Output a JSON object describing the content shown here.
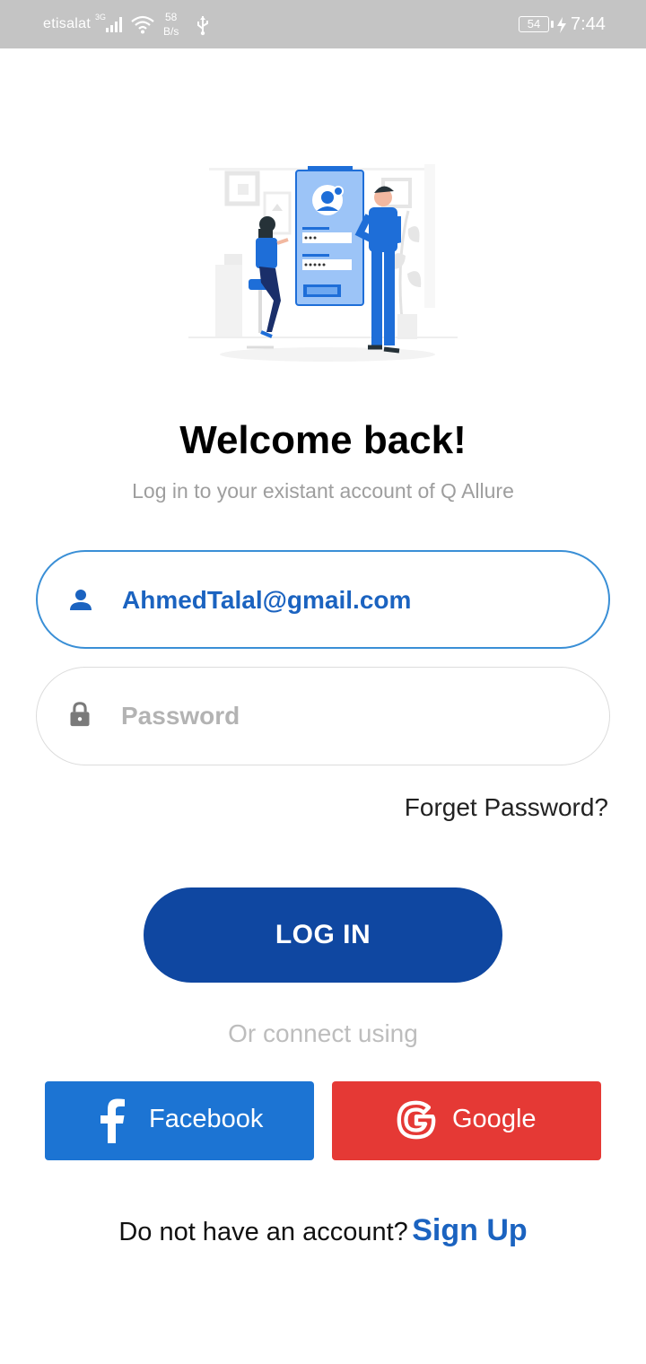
{
  "status_bar": {
    "carrier": "etisalat",
    "network_type": "3G",
    "speed_value": "58",
    "speed_unit": "B/s",
    "battery_level": "54",
    "time": "7:44",
    "icons": [
      "signal-icon",
      "wifi-icon",
      "usb-icon",
      "battery-icon",
      "charging-icon"
    ]
  },
  "login": {
    "title": "Welcome back!",
    "subtitle": "Log in to your existant account of Q Allure",
    "email_value": "AhmedTalal@gmail.com",
    "password_placeholder": "Password",
    "forgot_label": "Forget Password?",
    "login_button_label": "LOG IN",
    "connect_label": "Or connect using"
  },
  "social": {
    "facebook_label": "Facebook",
    "google_label": "Google"
  },
  "signup": {
    "prompt": "Do not have an account?",
    "link_label": "Sign Up"
  },
  "colors": {
    "primary": "#0f47a1",
    "link": "#1b63c0",
    "facebook": "#1c74d3",
    "google": "#e53935",
    "status_bar": "#c4c4c4"
  }
}
